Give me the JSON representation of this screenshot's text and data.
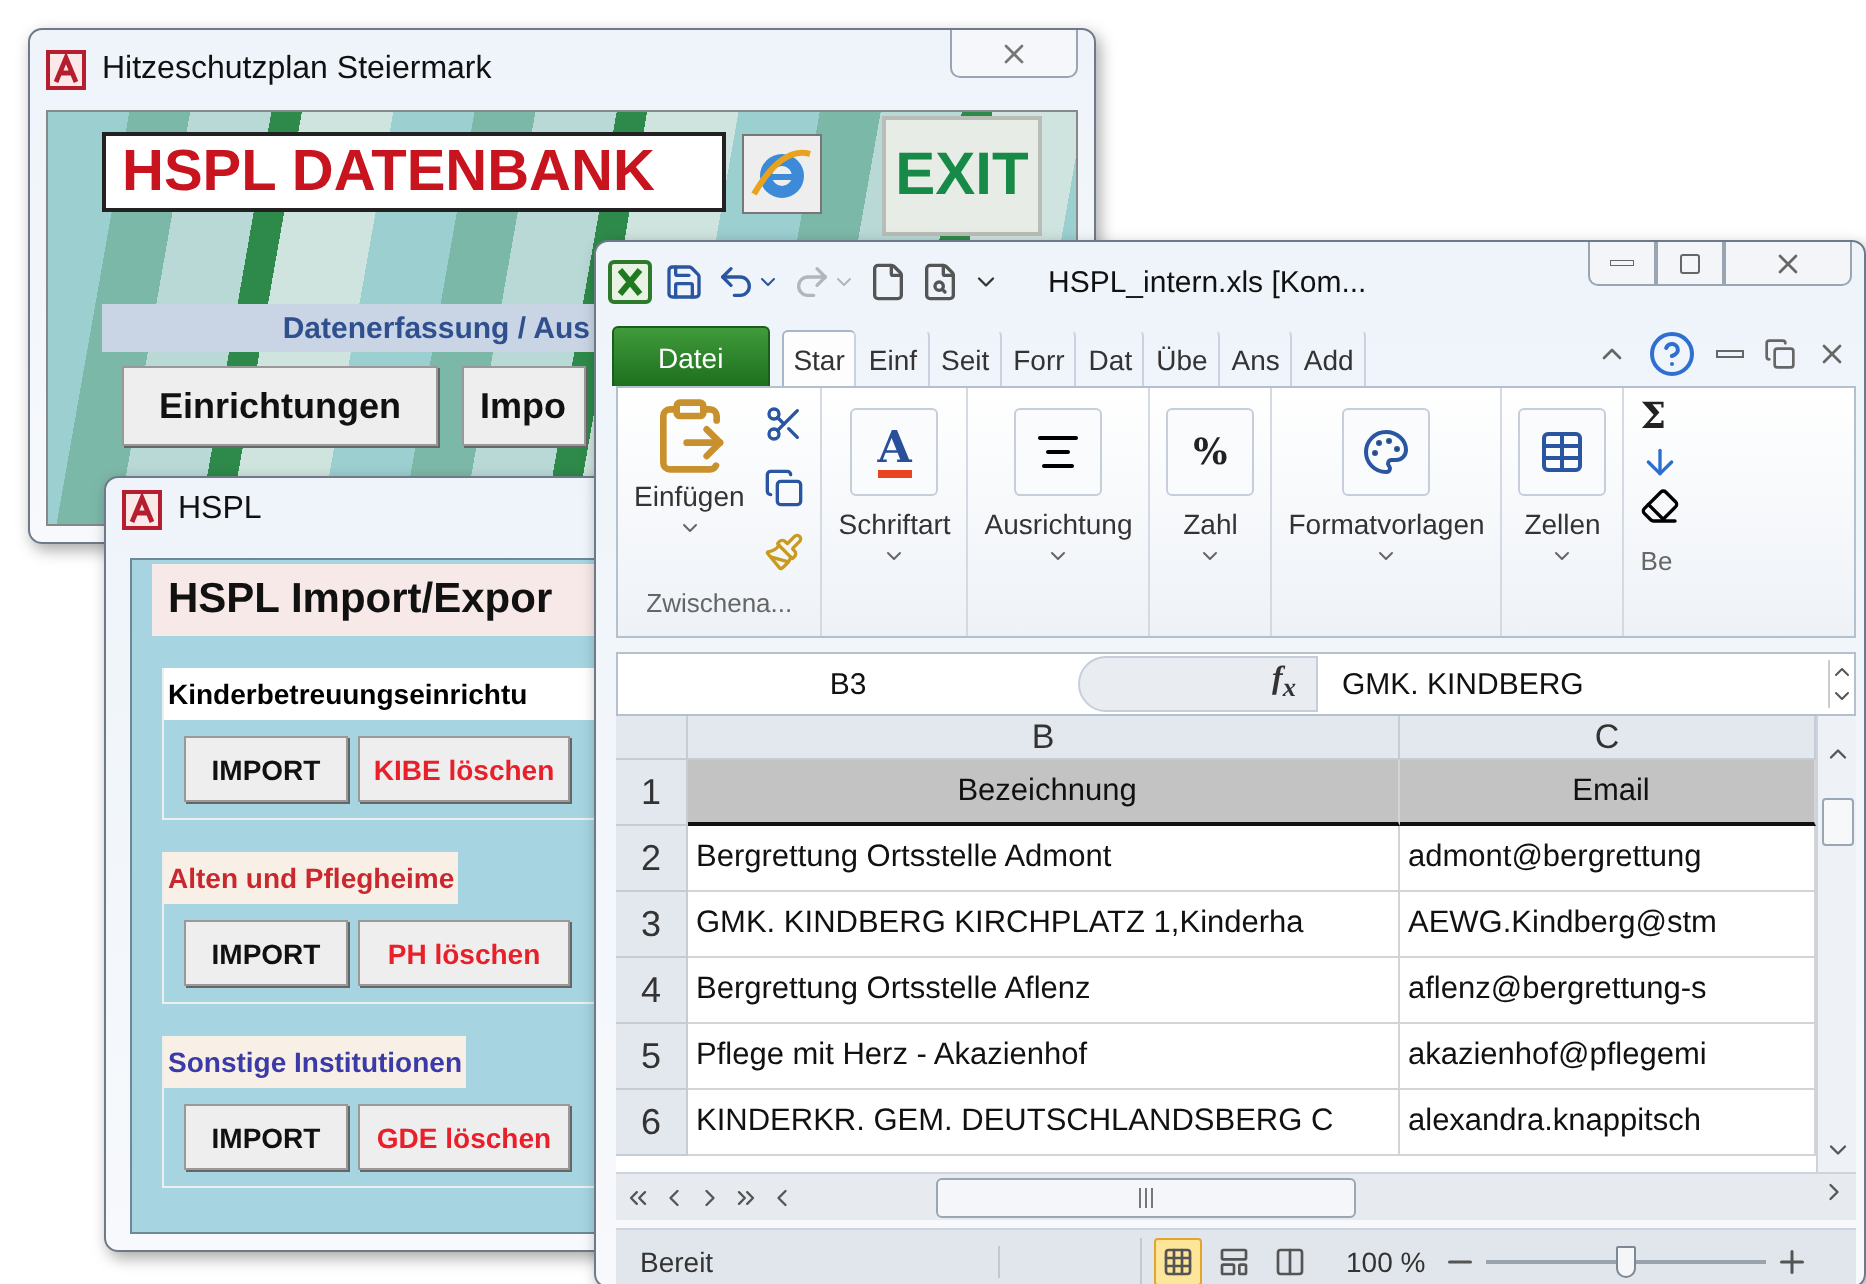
{
  "main_window": {
    "title": "Hitzeschutzplan Steiermark",
    "banner": "HSPL DATENBANK",
    "exit_sign": "EXIT",
    "section_label": "Datenerfassung / Aus",
    "buttons": [
      "Einrichtungen",
      "Impo"
    ]
  },
  "import_window": {
    "title": "HSPL",
    "heading": "HSPL Import/Expor",
    "groups": [
      {
        "label": "Kinderbetreuungseinrichtu",
        "color": "#000000",
        "buttons": [
          {
            "label": "IMPORT",
            "kind": "import"
          },
          {
            "label": "KIBE löschen",
            "kind": "delete"
          }
        ]
      },
      {
        "label": "Alten und Pflegheime",
        "color": "#c8282e",
        "buttons": [
          {
            "label": "IMPORT",
            "kind": "import"
          },
          {
            "label": "PH löschen",
            "kind": "delete"
          }
        ]
      },
      {
        "label": "Sonstige Institutionen",
        "color": "#3a3aa8",
        "buttons": [
          {
            "label": "IMPORT",
            "kind": "import"
          },
          {
            "label": "GDE löschen",
            "kind": "delete"
          }
        ]
      }
    ]
  },
  "excel": {
    "title": "HSPL_intern.xls  [Kom...",
    "tabs": [
      {
        "label": "Datei",
        "kind": "file",
        "selected": false
      },
      {
        "label": "Star",
        "kind": "tab",
        "selected": true
      },
      {
        "label": "Einf",
        "kind": "tab",
        "selected": false
      },
      {
        "label": "Seit",
        "kind": "tab",
        "selected": false
      },
      {
        "label": "Forr",
        "kind": "tab",
        "selected": false
      },
      {
        "label": "Dat",
        "kind": "tab",
        "selected": false
      },
      {
        "label": "Übe",
        "kind": "tab",
        "selected": false
      },
      {
        "label": "Ans",
        "kind": "tab",
        "selected": false
      },
      {
        "label": "Add",
        "kind": "tab",
        "selected": false
      }
    ],
    "ribbon_groups": [
      {
        "kind": "clipboard",
        "label": "Zwischena...",
        "command": "Einfügen"
      },
      {
        "kind": "font",
        "command": "Schriftart",
        "glyph": "A"
      },
      {
        "kind": "alignment",
        "command": "Ausrichtung"
      },
      {
        "kind": "number",
        "command": "Zahl",
        "glyph": "%"
      },
      {
        "kind": "styles",
        "command": "Formatvorlagen"
      },
      {
        "kind": "cells",
        "command": "Zellen"
      },
      {
        "kind": "editing",
        "label": "Be",
        "glyph": "Σ"
      }
    ],
    "name_box": "B3",
    "fx": "f$_{x}$",
    "formula": "GMK. KINDBERG",
    "columns": [
      "B",
      "C"
    ],
    "rows": [
      {
        "number": "1",
        "kind": "header",
        "cells": [
          "Bezeichnung",
          "Email"
        ]
      },
      {
        "number": "2",
        "kind": "data",
        "cells": [
          "Bergrettung Ortsstelle Admont",
          "admont@bergrettung"
        ]
      },
      {
        "number": "3",
        "kind": "data",
        "cells": [
          "GMK. KINDBERG KIRCHPLATZ 1,Kinderha",
          "AEWG.Kindberg@stm"
        ]
      },
      {
        "number": "4",
        "kind": "data",
        "cells": [
          "Bergrettung Ortsstelle Aflenz",
          "aflenz@bergrettung-s"
        ]
      },
      {
        "number": "5",
        "kind": "data",
        "cells": [
          "Pflege mit Herz -  Akazienhof",
          "akazienhof@pflegemi"
        ]
      },
      {
        "number": "6",
        "kind": "data",
        "cells": [
          "KINDERKR. GEM. DEUTSCHLANDSBERG C",
          "alexandra.knappitsch"
        ]
      }
    ],
    "status": {
      "text": "Bereit",
      "views": [
        {
          "kind": "normal",
          "selected": true
        },
        {
          "kind": "layout",
          "selected": false
        },
        {
          "kind": "pagebreak",
          "selected": false
        }
      ],
      "zoom": "100 %",
      "zoom_slider": {
        "level": 0.5
      }
    }
  }
}
